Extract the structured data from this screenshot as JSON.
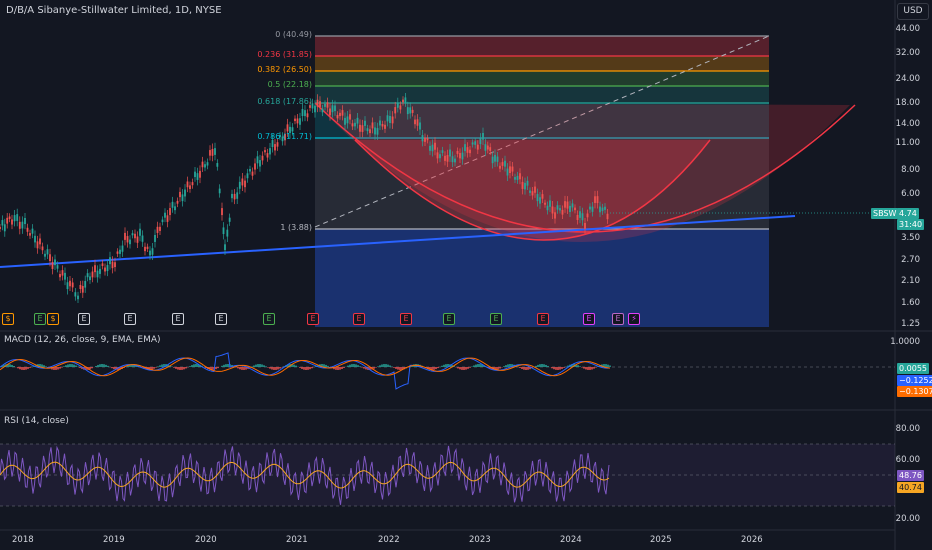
{
  "header": {
    "title": "D/B/A Sibanye-Stillwater Limited, 1D, NYSE",
    "currency": "USD"
  },
  "price_axis": [
    "44.00",
    "32.00",
    "24.00",
    "18.00",
    "14.00",
    "11.00",
    "8.00",
    "6.00",
    "3.50",
    "2.70",
    "2.10",
    "1.60",
    "1.25"
  ],
  "fib_levels": [
    {
      "label": "0 (40.49)",
      "color": "#9598a1"
    },
    {
      "label": "0.236 (31.85)",
      "color": "#f23645"
    },
    {
      "label": "0.382 (26.50)",
      "color": "#ff9800"
    },
    {
      "label": "0.5 (22.18)",
      "color": "#4caf50"
    },
    {
      "label": "0.618 (17.86)",
      "color": "#26a69a"
    },
    {
      "label": "0.786 (11.71)",
      "color": "#00bcd4"
    },
    {
      "label": "1 (3.88)",
      "color": "#b2b5be"
    }
  ],
  "price_badges": {
    "symbol": "SBSW",
    "price": "4.74",
    "countdown": "31:40"
  },
  "events": [
    "$",
    "E",
    "$",
    "E",
    "E",
    "E",
    "E",
    "E",
    "E",
    "E",
    "E",
    "E",
    "E",
    "E",
    "E",
    "E",
    "⚡",
    "E"
  ],
  "macd": {
    "title": "MACD (12, 26, close, 9, EMA, EMA)",
    "axis_top": "1.0000",
    "values": [
      "0.0055",
      "−0.1252",
      "−0.1307"
    ],
    "colors": [
      "#26a69a",
      "#2962ff",
      "#ff6d00"
    ]
  },
  "rsi": {
    "title": "RSI (14, close)",
    "axis": [
      "80.00",
      "60.00",
      "20.00"
    ],
    "values": [
      "48.76",
      "40.74"
    ],
    "colors": [
      "#7e57c2",
      "#f6a623"
    ]
  },
  "time_axis": [
    "2018",
    "2019",
    "2020",
    "2021",
    "2022",
    "2023",
    "2024",
    "2025",
    "2026"
  ],
  "colors": {
    "bg": "#131722",
    "up": "#26a69a",
    "down": "#ef5350",
    "trendline": "#2962ff",
    "arc": "#f23645"
  }
}
